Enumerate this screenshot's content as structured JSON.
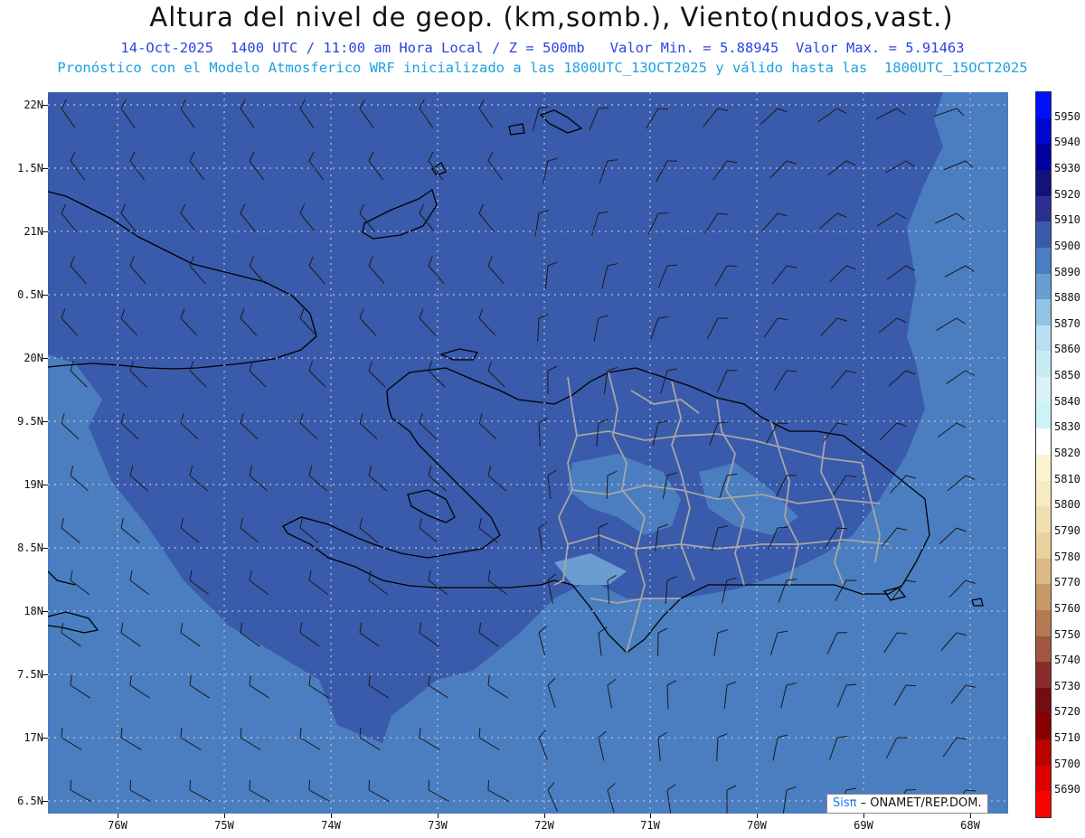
{
  "header": {
    "title": "Altura del nivel de geop. (km,somb.), Viento(nudos,vast.)",
    "subtitle": "14-Oct-2025  1400 UTC / 11:00 am Hora Local / Z = 500mb   Valor Min. = 5.88945  Valor Max. = 5.91463",
    "subtitle2": "Pronóstico con el Modelo Atmosferico WRF inicializado a las 1800UTC_13OCT2025 y válido hasta las  1800UTC_15OCT2025"
  },
  "axes": {
    "lat_labels": [
      "22N",
      "1.5N",
      "21N",
      "0.5N",
      "20N",
      "9.5N",
      "19N",
      "8.5N",
      "18N",
      "7.5N",
      "17N",
      "6.5N"
    ],
    "lon_labels": [
      "76W",
      "75W",
      "74W",
      "73W",
      "72W",
      "71W",
      "70W",
      "69W",
      "68W"
    ]
  },
  "colorbar": {
    "labels": [
      "5950",
      "5940",
      "5930",
      "5920",
      "5910",
      "5900",
      "5890",
      "5880",
      "5870",
      "5860",
      "5850",
      "5840",
      "5830",
      "5820",
      "5810",
      "5800",
      "5790",
      "5780",
      "5770",
      "5760",
      "5750",
      "5740",
      "5730",
      "5720",
      "5710",
      "5700",
      "5690"
    ],
    "colors": [
      "#0010ff",
      "#0008d0",
      "#0000a0",
      "#12127a",
      "#2a2f90",
      "#3a5aab",
      "#4a7ec0",
      "#6a9ed0",
      "#90c4e4",
      "#b8e0f0",
      "#c8ecf4",
      "#d8f2f8",
      "#ccf4f6",
      "#ffffff",
      "#fbf3d2",
      "#f6ebc2",
      "#f0e0b0",
      "#ead29e",
      "#dcb888",
      "#c89a68",
      "#b47a52",
      "#a05640",
      "#8a2c2c",
      "#740c14",
      "#880000",
      "#bb0000",
      "#e00000",
      "#ff0000"
    ],
    "colors_note_hidden": ""
  },
  "field_colors": {
    "level_5900": "#3a5aab",
    "level_5890": "#4a7ec0",
    "level_5880": "#6a9ed0",
    "coast": "#000000",
    "provinces": "#a6a6a6"
  },
  "credit": {
    "logo": "Sisπ",
    "text": "– ONAMET/REP.DOM."
  }
}
